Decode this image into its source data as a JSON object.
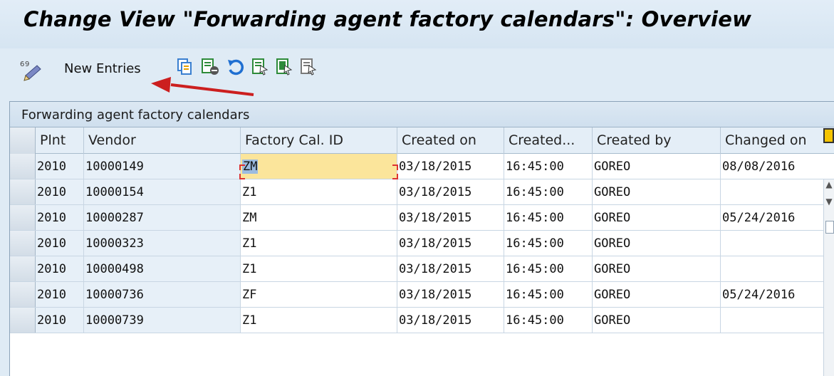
{
  "window": {
    "title": "Change View \"Forwarding agent factory calendars\": Overview"
  },
  "toolbar": {
    "new_entries_label": "New Entries",
    "icons": [
      "display-change-icon",
      "copy-icon",
      "delete-icon",
      "undo-icon",
      "select-all-icon",
      "select-block-icon",
      "deselect-all-icon"
    ]
  },
  "table": {
    "title": "Forwarding agent factory calendars",
    "columns": [
      "Plnt",
      "Vendor",
      "Factory Cal. ID",
      "Created on",
      "Created...",
      "Created by",
      "Changed on"
    ],
    "rows": [
      {
        "plant": "2010",
        "vendor": "10000149",
        "factory_cal": "ZM",
        "created_on": "03/18/2015",
        "created_at": "16:45:00",
        "created_by": "GOREO",
        "changed_on": "08/08/2016"
      },
      {
        "plant": "2010",
        "vendor": "10000154",
        "factory_cal": "Z1",
        "created_on": "03/18/2015",
        "created_at": "16:45:00",
        "created_by": "GOREO",
        "changed_on": ""
      },
      {
        "plant": "2010",
        "vendor": "10000287",
        "factory_cal": "ZM",
        "created_on": "03/18/2015",
        "created_at": "16:45:00",
        "created_by": "GOREO",
        "changed_on": "05/24/2016"
      },
      {
        "plant": "2010",
        "vendor": "10000323",
        "factory_cal": "Z1",
        "created_on": "03/18/2015",
        "created_at": "16:45:00",
        "created_by": "GOREO",
        "changed_on": ""
      },
      {
        "plant": "2010",
        "vendor": "10000498",
        "factory_cal": "Z1",
        "created_on": "03/18/2015",
        "created_at": "16:45:00",
        "created_by": "GOREO",
        "changed_on": ""
      },
      {
        "plant": "2010",
        "vendor": "10000736",
        "factory_cal": "ZF",
        "created_on": "03/18/2015",
        "created_at": "16:45:00",
        "created_by": "GOREO",
        "changed_on": "05/24/2016"
      },
      {
        "plant": "2010",
        "vendor": "10000739",
        "factory_cal": "Z1",
        "created_on": "03/18/2015",
        "created_at": "16:45:00",
        "created_by": "GOREO",
        "changed_on": ""
      }
    ]
  },
  "colors": {
    "background": "#dfebf5",
    "focus_field": "#fbe59b",
    "annotation_arrow": "#cc1f1f"
  }
}
